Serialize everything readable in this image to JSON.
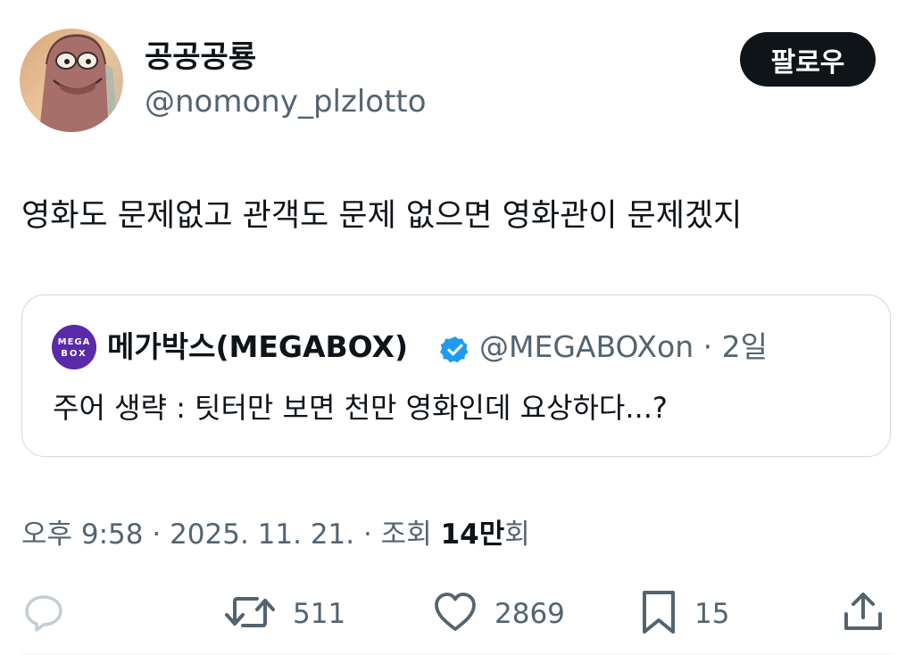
{
  "author": {
    "display_name": "공공공룡",
    "handle": "@nomony_plzlotto"
  },
  "follow_button": {
    "label": "팔로우"
  },
  "tweet": {
    "text": "영화도 문제없고 관객도 문제 없으면 영화관이 문제겠지"
  },
  "quote": {
    "avatar_lines": [
      "MEGA",
      "BOX"
    ],
    "display_name": "메가박스(MEGABOX)",
    "handle_time": "@MEGABOXon · 2일",
    "text": "주어 생략 : 팃터만 보면 천만 영화인데 요상하다...?"
  },
  "meta": {
    "time_date": "오후 9:58 · 2025. 11. 21. · 조회 ",
    "views_number": "14만",
    "views_suffix": "회"
  },
  "actions": {
    "reply_icon": "reply-icon",
    "retweet_count": "511",
    "like_count": "2869",
    "bookmark_count": "15",
    "share_icon": "share-icon"
  },
  "colors": {
    "text_primary": "#0f1419",
    "text_secondary": "#536471",
    "verified_blue": "#1d9bf0",
    "border": "#cfd9de",
    "megabox_purple": "#5b2aa9"
  }
}
